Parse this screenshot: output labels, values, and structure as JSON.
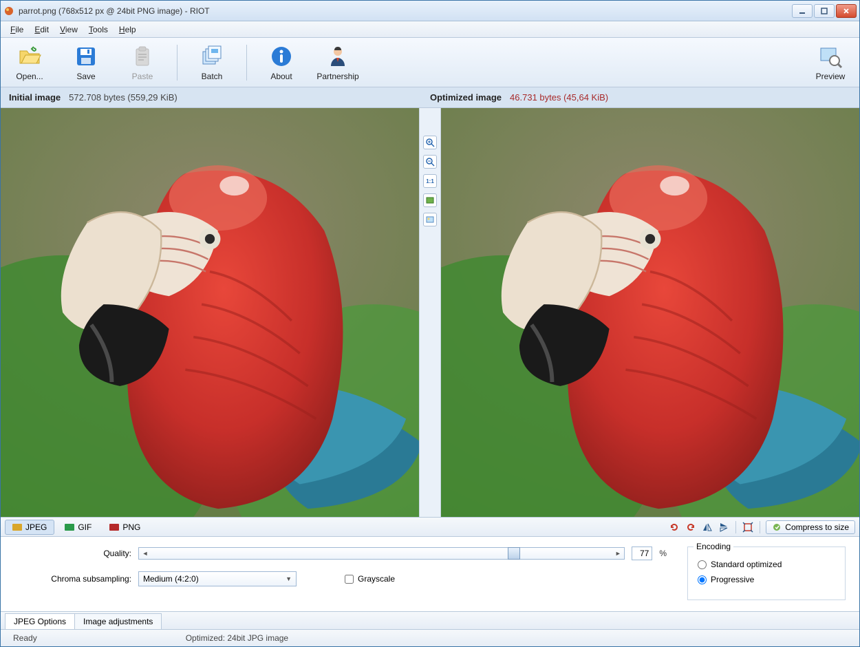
{
  "window": {
    "title": "parrot.png (768x512 px @ 24bit PNG image) - RIOT"
  },
  "menubar": {
    "items": [
      {
        "label": "File",
        "accel": "F"
      },
      {
        "label": "Edit",
        "accel": "E"
      },
      {
        "label": "View",
        "accel": "V"
      },
      {
        "label": "Tools",
        "accel": "T"
      },
      {
        "label": "Help",
        "accel": "H"
      }
    ]
  },
  "toolbar": {
    "open": "Open...",
    "save": "Save",
    "paste": "Paste",
    "batch": "Batch",
    "about": "About",
    "partnership": "Partnership",
    "preview": "Preview"
  },
  "infobar": {
    "initial_label": "Initial image",
    "initial_bytes": "572.708 bytes (559,29 KiB)",
    "optimized_label": "Optimized image",
    "optimized_bytes": "46.731 bytes (45,64 KiB)"
  },
  "center_tools": {
    "zoom_in": "zoom-in",
    "zoom_out": "zoom-out",
    "one_to_one": "1:1",
    "fit_a": "fit",
    "fit_b": "bg"
  },
  "format_tabs": {
    "jpeg": "JPEG",
    "gif": "GIF",
    "png": "PNG"
  },
  "right_toolbar": {
    "undo": "undo",
    "redo": "redo",
    "flip_h": "flip-h",
    "flip_v": "flip-v",
    "crop": "crop",
    "compress_label": "Compress to size"
  },
  "options": {
    "quality_label": "Quality:",
    "quality_value": "77",
    "quality_pct": "%",
    "chroma_label": "Chroma subsampling:",
    "chroma_value": "Medium (4:2:0)",
    "grayscale_label": "Grayscale",
    "encoding_legend": "Encoding",
    "encoding_standard": "Standard optimized",
    "encoding_progressive": "Progressive"
  },
  "bottom_tabs": {
    "jpeg_options": "JPEG Options",
    "image_adjustments": "Image adjustments"
  },
  "statusbar": {
    "ready": "Ready",
    "optimized": "Optimized: 24bit JPG image"
  }
}
